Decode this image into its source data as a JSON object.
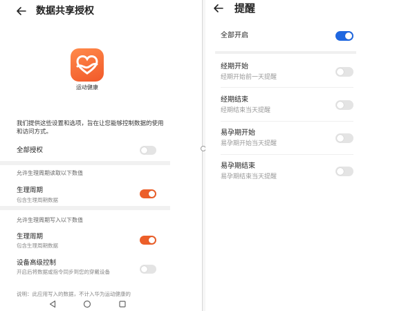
{
  "left": {
    "title": "数据共享授权",
    "app_name": "运动健康",
    "description": "我们提供这些设置和选项，旨在让您能够控制数据的使用和访问方式。",
    "all_auth": {
      "label": "全部授权",
      "on": false
    },
    "read_section": "允许生理周期读取以下数值",
    "read_item": {
      "label": "生理周期",
      "sub": "包含生理周期数据",
      "on": true
    },
    "write_section": "允许生理周期写入以下数值",
    "write_item": {
      "label": "生理周期",
      "sub": "包含生理周期数据",
      "on": true
    },
    "advanced": {
      "label": "设备高级控制",
      "sub": "开启后将数据或指令同步到您的穿戴设备",
      "on": false
    },
    "note": "说明：此应用写入的数据，不计入华为运动健康的"
  },
  "right": {
    "title": "提醒",
    "all_on": {
      "label": "全部开启",
      "on": true
    },
    "items": [
      {
        "label": "经期开始",
        "sub": "经期开始前一天提醒",
        "on": false
      },
      {
        "label": "经期结束",
        "sub": "经期结束当天提醒",
        "on": false
      },
      {
        "label": "易孕期开始",
        "sub": "易孕期开始当天提醒",
        "on": false
      },
      {
        "label": "易孕期结束",
        "sub": "易孕期结束当天提醒",
        "on": false
      }
    ]
  },
  "colors": {
    "orange_on": "#ec5f2a",
    "blue_on": "#1f67e0",
    "off": "#e4e4e4"
  },
  "icons": {
    "back": "arrow-left",
    "app": "heart-app-icon",
    "nav": [
      "triangle-back",
      "circle-home",
      "square-recents"
    ]
  }
}
